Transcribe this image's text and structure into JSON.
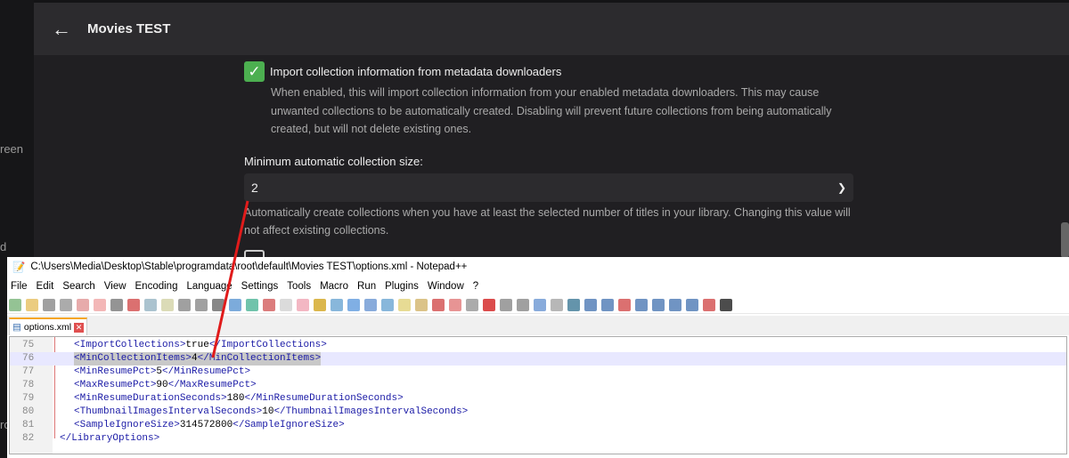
{
  "background_sidebar": {
    "fragments": [
      "reen",
      "d",
      "ro"
    ]
  },
  "header": {
    "back_icon": "arrow-left-icon",
    "title": "Movies TEST"
  },
  "settings": {
    "import_collections": {
      "checked": true,
      "label": "Import collection information from metadata downloaders",
      "description": "When enabled, this will import collection information from your enabled metadata downloaders. This may cause unwanted collections to be automatically created. Disabling will prevent future collections from being automatically created, but will not delete existing ones."
    },
    "min_collection_size": {
      "label": "Minimum automatic collection size:",
      "value": "2",
      "description": "Automatically create collections when you have at least the selected number of titles in your library. Changing this value will not affect existing collections."
    }
  },
  "notepad": {
    "title": "C:\\Users\\Media\\Desktop\\Stable\\programdata\\root\\default\\Movies TEST\\options.xml - Notepad++",
    "menu": [
      "File",
      "Edit",
      "Search",
      "View",
      "Encoding",
      "Language",
      "Settings",
      "Tools",
      "Macro",
      "Run",
      "Plugins",
      "Window",
      "?"
    ],
    "tab": "options.xml",
    "lines": [
      {
        "n": "75",
        "tag": "ImportCollections",
        "value": "true",
        "indent": "  "
      },
      {
        "n": "76",
        "tag": "MinCollectionItems",
        "value": "4",
        "indent": "  ",
        "current": true
      },
      {
        "n": "77",
        "tag": "MinResumePct",
        "value": "5",
        "indent": "  "
      },
      {
        "n": "78",
        "tag": "MaxResumePct",
        "value": "90",
        "indent": "  "
      },
      {
        "n": "79",
        "tag": "MinResumeDurationSeconds",
        "value": "180",
        "indent": "  "
      },
      {
        "n": "80",
        "tag": "ThumbnailImagesIntervalSeconds",
        "value": "10",
        "indent": "  "
      },
      {
        "n": "81",
        "tag": "SampleIgnoreSize",
        "value": "314572800",
        "indent": "  "
      },
      {
        "n": "82",
        "close": "</LibraryOptions>",
        "indent": ""
      }
    ]
  },
  "colors": {
    "accent_green": "#4caf50",
    "annotation_red": "#e01b1b"
  }
}
